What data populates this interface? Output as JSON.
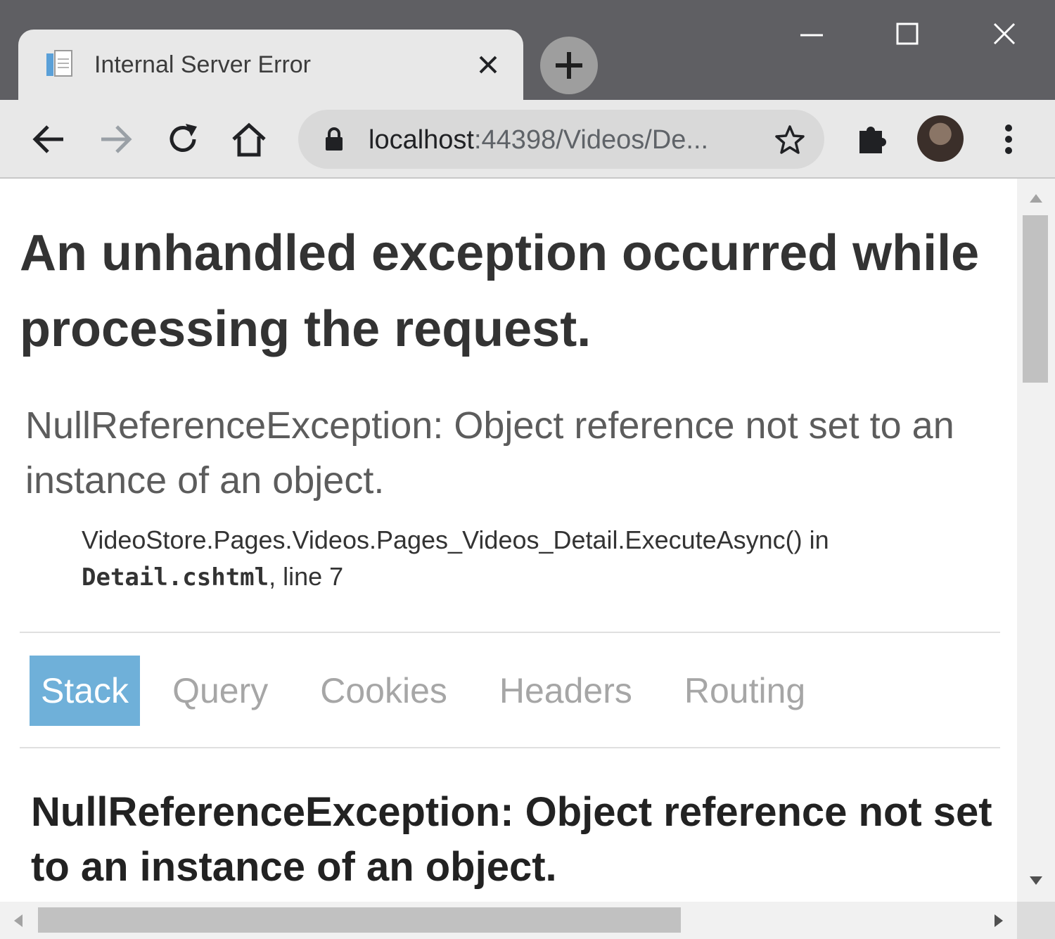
{
  "browser": {
    "tab": {
      "title": "Internal Server Error",
      "favicon": "page-icon"
    },
    "new_tab_icon": "plus-icon",
    "window_controls": [
      "minimize-icon",
      "maximize-icon",
      "close-icon"
    ],
    "toolbar": {
      "icons": [
        "back-arrow-icon",
        "forward-arrow-icon",
        "reload-icon",
        "home-icon",
        "puzzle-extensions-icon",
        "kebab-menu-icon"
      ],
      "url_host": "localhost",
      "url_rest": ":44398/Videos/De...",
      "lock_icon": "lock-icon",
      "star_icon": "bookmark-star-icon"
    }
  },
  "page": {
    "heading": "An unhandled exception occurred while processing the request.",
    "exception_message": "NullReferenceException: Object reference not set to an instance of an object.",
    "location": {
      "method": "VideoStore.Pages.Videos.Pages_Videos_Detail.ExecuteAsync() in",
      "file": "Detail.cshtml",
      "line": ", line 7"
    },
    "tabs": [
      {
        "label": "Stack",
        "active": true
      },
      {
        "label": "Query",
        "active": false
      },
      {
        "label": "Cookies",
        "active": false
      },
      {
        "label": "Headers",
        "active": false
      },
      {
        "label": "Routing",
        "active": false
      }
    ],
    "stack_heading": "NullReferenceException: Object reference not set to an instance of an object."
  },
  "colors": {
    "active_tab": "#6fb0d9",
    "title_bar": "#5f5f63",
    "toolbar": "#e8e8e8"
  }
}
